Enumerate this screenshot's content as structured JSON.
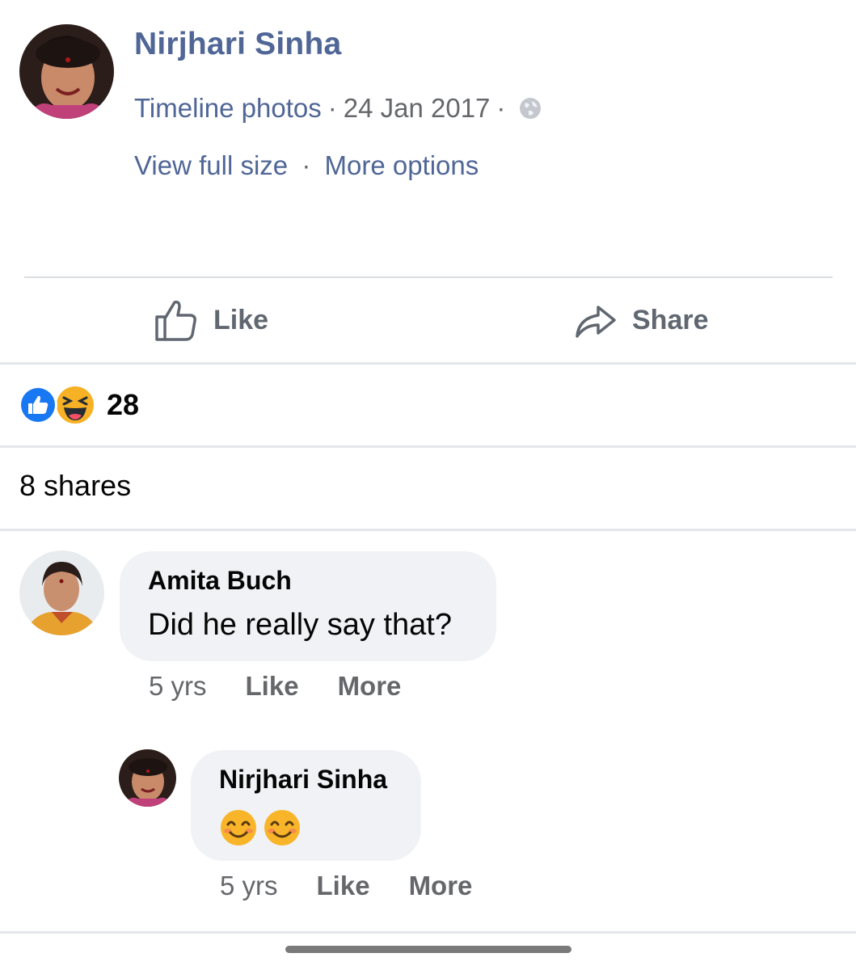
{
  "post": {
    "author": "Nirjhari Sinha",
    "source": "Timeline photos",
    "date": "24 Jan 2017",
    "separator": "·",
    "privacy_icon": "globe-icon",
    "view_full_size": "View full size",
    "more_options": "More options"
  },
  "actions": {
    "like_label": "Like",
    "share_label": "Share"
  },
  "reactions": {
    "types": [
      "like-reaction-icon",
      "haha-reaction-icon"
    ],
    "count": "28"
  },
  "shares_text": "8 shares",
  "comments": [
    {
      "author": "Amita Buch",
      "text": "Did he really say that?",
      "time": "5 yrs",
      "like_label": "Like",
      "more_label": "More"
    },
    {
      "author": "Nirjhari Sinha",
      "text_emojis": [
        "smiling-face-emoji",
        "smiling-face-emoji"
      ],
      "time": "5 yrs",
      "like_label": "Like",
      "more_label": "More"
    }
  ],
  "colors": {
    "link": "#4f6696",
    "muted": "#65676b",
    "bubble": "#f0f2f5",
    "like_blue": "#1877f2",
    "haha_yellow": "#f7b125"
  }
}
